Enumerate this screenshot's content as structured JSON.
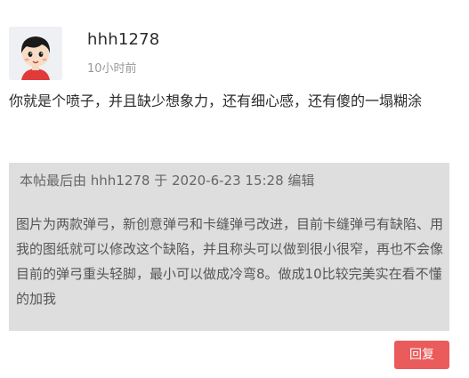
{
  "post": {
    "avatar_icon": "cartoon-boy-avatar-icon",
    "username": "hhh1278",
    "time": "10小时前",
    "content": "你就是个喷子，并且缺少想象力，还有细心感，还有傻的一塌糊涂",
    "quote": {
      "edit_note": "本帖最后由 hhh1278 于 2020-6-23 15:28 编辑",
      "body": "图片为两款弹弓，新创意弹弓和卡缝弹弓改进，目前卡缝弹弓有缺陷、用我的图纸就可以修改这个缺陷，并且称头可以做到很小很窄，再也不会像目前的弹弓重头轻脚，最小可以做成冷弯8。做成10比较完美实在看不懂的加我"
    },
    "reply_label": "回复"
  },
  "colors": {
    "quote_background": "#dedede",
    "reply_button": "#ea5b5b"
  }
}
